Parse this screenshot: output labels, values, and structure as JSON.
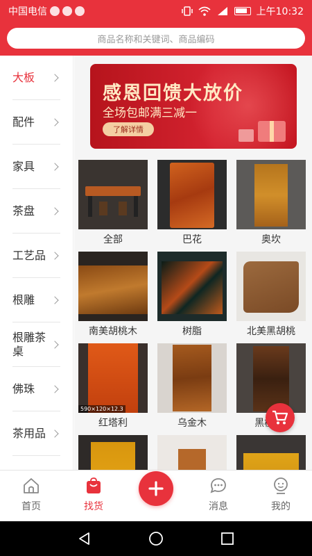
{
  "status_bar": {
    "carrier": "中国电信",
    "time": "上午10:32"
  },
  "search": {
    "placeholder": "商品名称和关键词、商品编码"
  },
  "sidebar": {
    "items": [
      {
        "label": "大板",
        "active": true
      },
      {
        "label": "配件",
        "active": false
      },
      {
        "label": "家具",
        "active": false
      },
      {
        "label": "茶盘",
        "active": false
      },
      {
        "label": "工艺品",
        "active": false
      },
      {
        "label": "根雕",
        "active": false
      },
      {
        "label": "根雕茶桌",
        "active": false
      },
      {
        "label": "佛珠",
        "active": false
      },
      {
        "label": "茶用品",
        "active": false
      }
    ]
  },
  "banner": {
    "title": "感恩回馈大放价",
    "subtitle": "全场包邮满三减一",
    "button_label": "了解详情"
  },
  "categories": [
    {
      "label": "全部"
    },
    {
      "label": "巴花"
    },
    {
      "label": "奥坎"
    },
    {
      "label": "南美胡桃木"
    },
    {
      "label": "树脂"
    },
    {
      "label": "北美黑胡桃"
    },
    {
      "label": "红塔利",
      "size_tag": "590×120×12.3"
    },
    {
      "label": "乌金木"
    },
    {
      "label": "黑檀(大"
    },
    {
      "label": ""
    },
    {
      "label": ""
    },
    {
      "label": ""
    }
  ],
  "bottom_nav": {
    "items": [
      {
        "label": "首页",
        "icon": "home-icon"
      },
      {
        "label": "找货",
        "icon": "bag-icon"
      },
      {
        "label": "",
        "icon": "plus-icon"
      },
      {
        "label": "消息",
        "icon": "message-icon"
      },
      {
        "label": "我的",
        "icon": "profile-icon"
      }
    ]
  },
  "colors": {
    "accent": "#e8323c",
    "wood": "#c05a1c"
  }
}
